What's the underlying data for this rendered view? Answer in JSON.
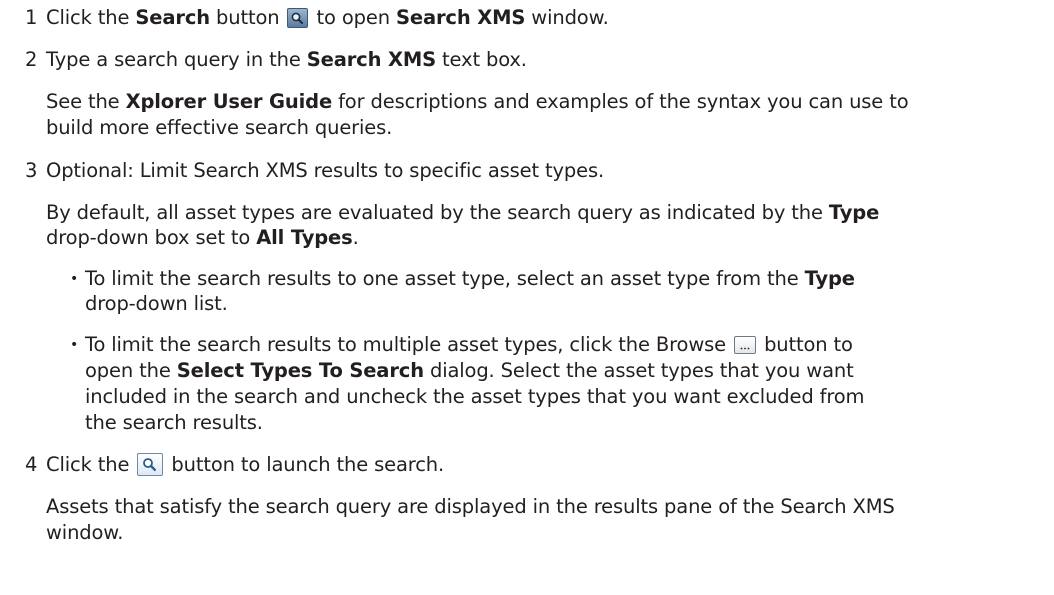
{
  "steps": [
    {
      "number": "1",
      "line": {
        "t1": "Click the ",
        "b1": "Search",
        "t2": " button ",
        "icon": "search-icon",
        "t3": " to open ",
        "b2": "Search XMS",
        "t4": " window."
      }
    },
    {
      "number": "2",
      "line": {
        "t1": "Type a search query in the ",
        "b1": "Search XMS",
        "t2": " text box."
      },
      "note": {
        "t1": "See the ",
        "b1": "Xplorer User Guide",
        "t2": " for descriptions and examples of the syntax you can use to",
        "l2": "build more effective search queries."
      }
    },
    {
      "number": "3",
      "line": {
        "t1": "Optional: Limit Search XMS results to specific asset types."
      },
      "note": {
        "t1": "By default, all asset types are evaluated by the search query as indicated by the ",
        "b1": "Type",
        "t2": "drop-down box set to ",
        "b2": "All Types",
        "t3": "."
      },
      "bullets": [
        {
          "symbol": "•",
          "t1": "To limit the search results to one asset type, select an asset type from the ",
          "b1": "Type",
          "l2": "drop-down list."
        },
        {
          "symbol": "•",
          "t1": "To limit the search results to multiple asset types, click the Browse ",
          "icon": "browse-icon",
          "t2": " button to",
          "l2a": "open the ",
          "b1": "Select Types To Search",
          "l2b": " dialog. Select the asset types that you want",
          "l3": "included in the search and uncheck the asset types that you want excluded from",
          "l4": "the search results."
        }
      ]
    },
    {
      "number": "4",
      "line": {
        "t1": "Click the ",
        "icon": "search-icon",
        "t2": " button to launch the search."
      },
      "note": {
        "l1": "Assets that satisfy the search query are displayed in the results pane of the Search XMS",
        "l2": "window."
      }
    }
  ]
}
